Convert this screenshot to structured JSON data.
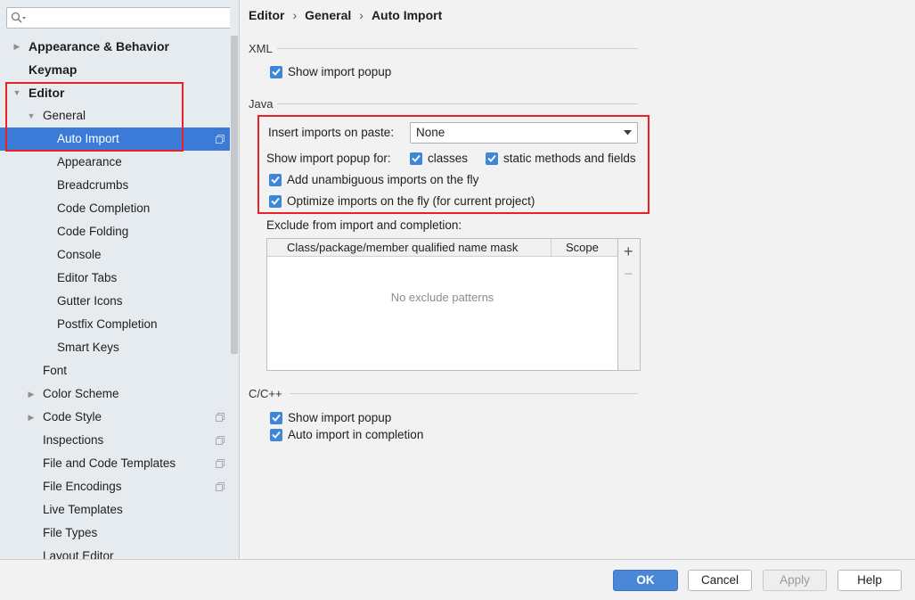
{
  "search": {
    "placeholder": "",
    "value": ""
  },
  "sidebar": {
    "items": [
      {
        "label": "Appearance & Behavior",
        "arrow": "▶"
      },
      {
        "label": "Keymap"
      },
      {
        "label": "Editor",
        "arrow": "▼"
      },
      {
        "label": "General",
        "arrow": "▼"
      },
      {
        "label": "Auto Import"
      },
      {
        "label": "Appearance"
      },
      {
        "label": "Breadcrumbs"
      },
      {
        "label": "Code Completion"
      },
      {
        "label": "Code Folding"
      },
      {
        "label": "Console"
      },
      {
        "label": "Editor Tabs"
      },
      {
        "label": "Gutter Icons"
      },
      {
        "label": "Postfix Completion"
      },
      {
        "label": "Smart Keys"
      },
      {
        "label": "Font"
      },
      {
        "label": "Color Scheme",
        "arrow": "▶"
      },
      {
        "label": "Code Style",
        "arrow": "▶"
      },
      {
        "label": "Inspections"
      },
      {
        "label": "File and Code Templates"
      },
      {
        "label": "File Encodings"
      },
      {
        "label": "Live Templates"
      },
      {
        "label": "File Types"
      },
      {
        "label": "Layout Editor"
      }
    ]
  },
  "breadcrumb": [
    "Editor",
    "General",
    "Auto Import"
  ],
  "breadcrumb_sep": "›",
  "xml": {
    "title": "XML",
    "show_popup": {
      "label": "Show import popup",
      "checked": true
    }
  },
  "java": {
    "title": "Java",
    "insert_label": "Insert imports on paste:",
    "insert_value": "None",
    "popup_for_label": "Show import popup for:",
    "classes": {
      "label": "classes",
      "checked": true
    },
    "static": {
      "label": "static methods and fields",
      "checked": true
    },
    "unambiguous": {
      "label": "Add unambiguous imports on the fly",
      "checked": true
    },
    "optimize": {
      "label": "Optimize imports on the fly (for current project)",
      "checked": true
    },
    "exclude_label": "Exclude from import and completion:",
    "table": {
      "columns": [
        "Class/package/member qualified name mask",
        "Scope"
      ],
      "empty_text": "No exclude patterns",
      "add": "+",
      "remove": "−"
    }
  },
  "cpp": {
    "title": "C/C++",
    "show_popup": {
      "label": "Show import popup",
      "checked": true
    },
    "auto_import": {
      "label": "Auto import in completion",
      "checked": true
    }
  },
  "footer": {
    "ok": "OK",
    "cancel": "Cancel",
    "apply": "Apply",
    "help": "Help"
  },
  "colors": {
    "accent": "#3c7ad8",
    "highlight_box": "#e8202a",
    "checkbox": "#3d86d8"
  }
}
